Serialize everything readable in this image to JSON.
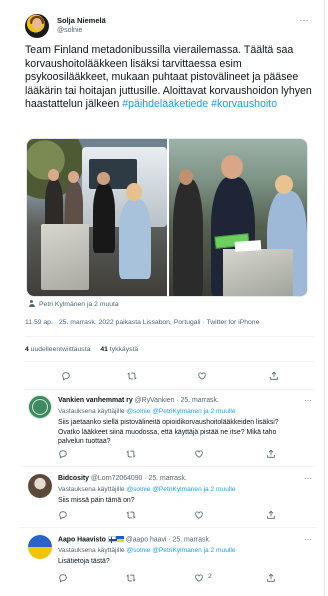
{
  "tweet": {
    "author_name": "Solja Niemelä",
    "author_handle": "@solnie",
    "more_label": "···",
    "text_plain": "Team Finland metadonibussilla vierailemassa. Täältä saa korvaushoitolääkkeen lisäksi tarvittaessa esim psykoosilääkkeet, mukaan puhtaat pistovälineet ja pääsee lääkärin tai hoitajan juttusille. Aloittavat korvaushoidon lyhyen haastattelun jälkeen ",
    "hashtag_1": "#päihdelääketiede",
    "hashtag_2": "#korvaushoito",
    "tagged_people": "Petri Kylmänen ja 2 muuta",
    "timestamp": "11.59 ap. · 25. marrask. 2022 paikasta Lissabon, Portugali · Twitter for iPhone",
    "retweets_count": "4",
    "retweets_label": "uudelleentwiittausta",
    "likes_count": "41",
    "likes_label": "tykkäystä"
  },
  "replies": [
    {
      "name": "Vankien vanhemmat ry",
      "handle_time": "@RyVankien · 25. marrask.",
      "replying_prefix": "Vastauksena käyttäjille",
      "replying_links": "@solnie @PetriKylmanen ja 2 muulle",
      "text": "Siis jaetaanko siellä pistovälineitä opioidikorvaushoitolääkkeiden lisäksi? Ovatko lääkkeet siinä muodossa, että käyttäjä pistää ne itse? Mikä taho palvelun tuottaa?",
      "more_label": "···",
      "avatar_color": "#3f8a5f"
    },
    {
      "name": "Bidcosity",
      "handle_time": "@Lorn72064090 · 25. marrask.",
      "replying_prefix": "Vastauksena käyttäjille",
      "replying_links": "@solnie @PetriKylmanen ja 2 muulle",
      "text": "Siis missä päin tämä on?",
      "more_label": "···",
      "avatar_color": "#5b4a3a"
    },
    {
      "name": "Aapo Haavisto",
      "handle_time": "@aapo haavi · 25. marrask.",
      "replying_prefix": "Vastauksena käyttäjille",
      "replying_links": "@solnie @PetriKylmanen ja 2 muulle",
      "text": "Lisätietoja tästä?",
      "more_label": "···",
      "like_count": "2",
      "avatar_color": "#2a64c6"
    }
  ],
  "icons": {
    "reply": "reply-icon",
    "retweet": "retweet-icon",
    "like": "heart-icon",
    "share": "share-icon"
  },
  "colors": {
    "link": "#1d9bf0",
    "muted": "#536471",
    "text": "#0f1419"
  }
}
